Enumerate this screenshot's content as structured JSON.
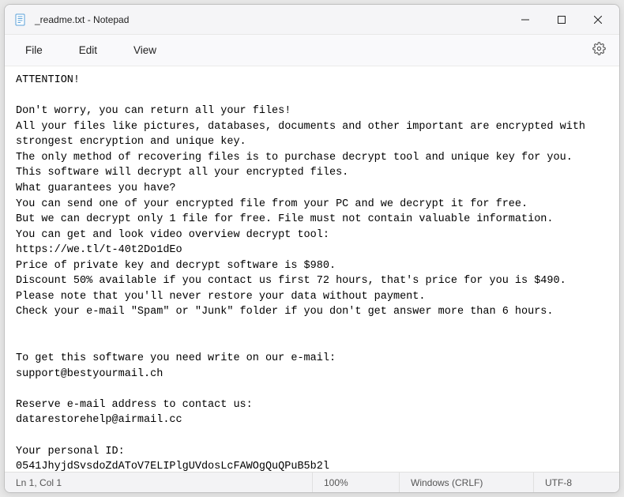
{
  "titlebar": {
    "title": "_readme.txt - Notepad"
  },
  "menubar": {
    "file": "File",
    "edit": "Edit",
    "view": "View"
  },
  "content": {
    "text": "ATTENTION!\n\nDon't worry, you can return all your files!\nAll your files like pictures, databases, documents and other important are encrypted with strongest encryption and unique key.\nThe only method of recovering files is to purchase decrypt tool and unique key for you.\nThis software will decrypt all your encrypted files.\nWhat guarantees you have?\nYou can send one of your encrypted file from your PC and we decrypt it for free.\nBut we can decrypt only 1 file for free. File must not contain valuable information.\nYou can get and look video overview decrypt tool:\nhttps://we.tl/t-40t2Do1dEo\nPrice of private key and decrypt software is $980.\nDiscount 50% available if you contact us first 72 hours, that's price for you is $490.\nPlease note that you'll never restore your data without payment.\nCheck your e-mail \"Spam\" or \"Junk\" folder if you don't get answer more than 6 hours.\n\n\nTo get this software you need write on our e-mail:\nsupport@bestyourmail.ch\n\nReserve e-mail address to contact us:\ndatarestorehelp@airmail.cc\n\nYour personal ID:\n0541JhyjdSvsdoZdAToV7ELIPlgUVdosLcFAWOgQuQPuB5b2l"
  },
  "statusbar": {
    "position": "Ln 1, Col 1",
    "zoom": "100%",
    "line_ending": "Windows (CRLF)",
    "encoding": "UTF-8"
  }
}
